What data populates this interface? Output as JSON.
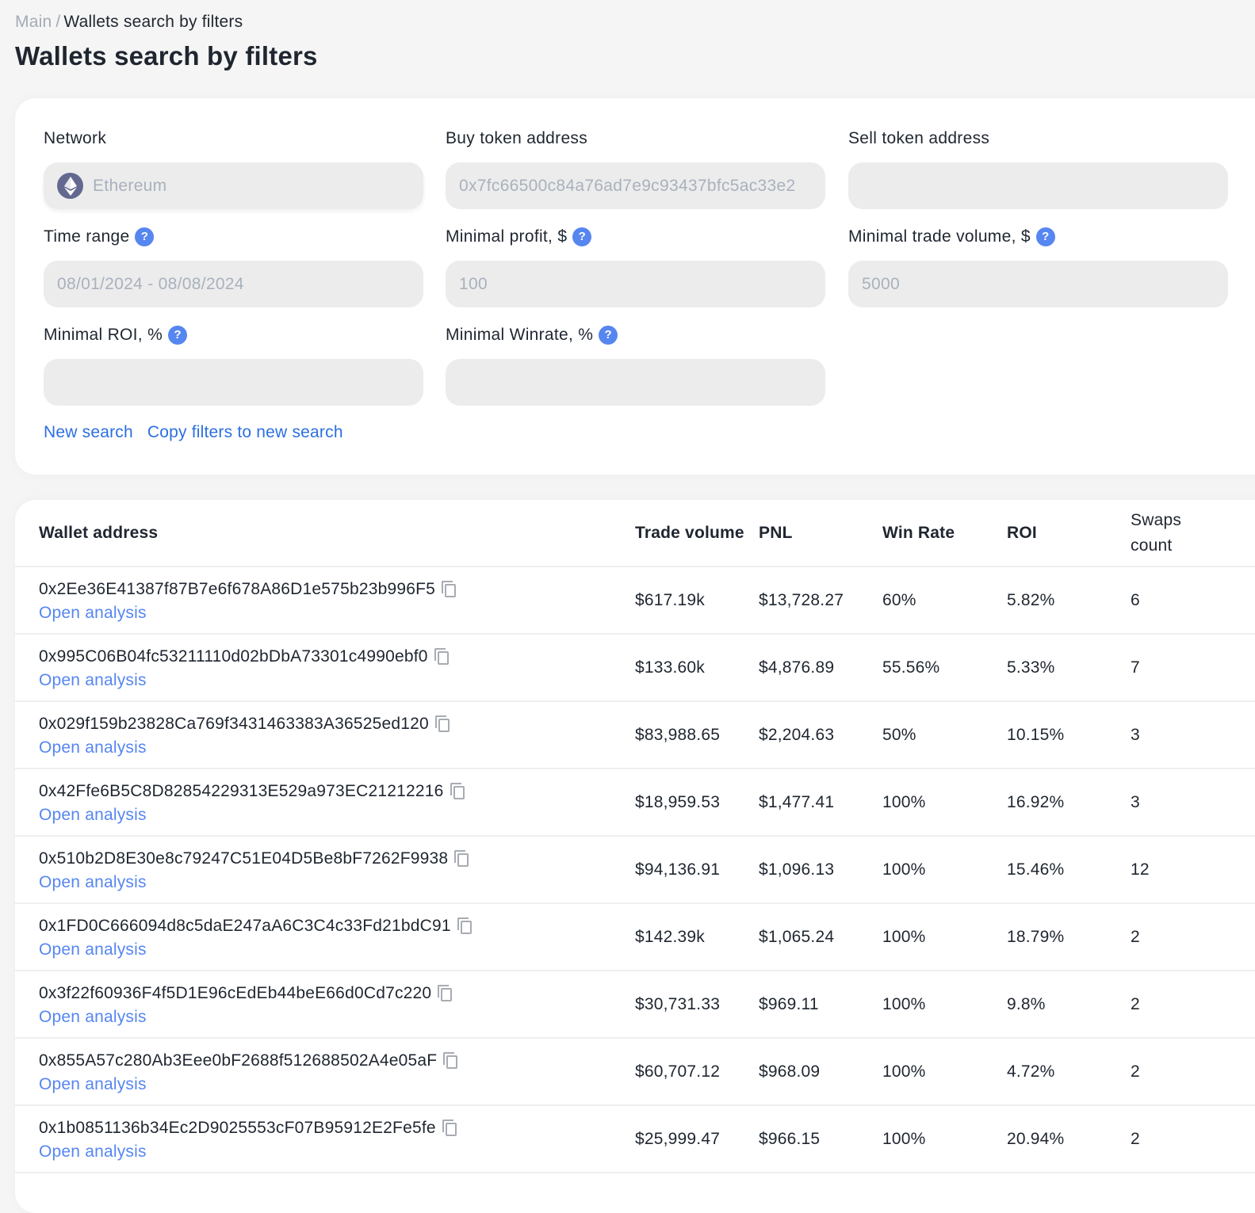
{
  "breadcrumb": {
    "root": "Main",
    "separator": "/",
    "current": "Wallets search by filters"
  },
  "page_title": "Wallets search by filters",
  "colors": {
    "accent": "#2c6fe0",
    "link": "#5686f0",
    "help": "#5686f0",
    "eth": "#62688f",
    "input_bg": "#ececec"
  },
  "filters": {
    "network": {
      "label": "Network",
      "value": "Ethereum",
      "icon": "ethereum-icon"
    },
    "buy_token": {
      "label": "Buy token address",
      "value": "0x7fc66500c84a76ad7e9c93437bfc5ac33e2"
    },
    "sell_token": {
      "label": "Sell token address",
      "value": ""
    },
    "time_range": {
      "label": "Time range",
      "value": "08/01/2024 - 08/08/2024",
      "help": "?"
    },
    "min_profit": {
      "label": "Minimal profit, $",
      "value": "100",
      "help": "?"
    },
    "min_volume": {
      "label": "Minimal trade volume, $",
      "value": "5000",
      "help": "?"
    },
    "min_roi": {
      "label": "Minimal ROI, %",
      "value": "",
      "help": "?"
    },
    "min_winrate": {
      "label": "Minimal Winrate, %",
      "value": "",
      "help": "?"
    },
    "actions": {
      "new_search": "New search",
      "copy_filters": "Copy filters to new search"
    }
  },
  "table": {
    "headers": {
      "wallet": "Wallet address",
      "volume": "Trade volume",
      "pnl": "PNL",
      "winrate": "Win Rate",
      "roi": "ROI",
      "swaps_line1": "Swaps",
      "swaps_line2": "count"
    },
    "open_label": "Open analysis",
    "rows": [
      {
        "address": "0x2Ee36E41387f87B7e6f678A86D1e575b23b996F5",
        "volume": "$617.19k",
        "pnl": "$13,728.27",
        "winrate": "60%",
        "roi": "5.82%",
        "swaps": "6"
      },
      {
        "address": "0x995C06B04fc53211110d02bDbA73301c4990ebf0",
        "volume": "$133.60k",
        "pnl": "$4,876.89",
        "winrate": "55.56%",
        "roi": "5.33%",
        "swaps": "7"
      },
      {
        "address": "0x029f159b23828Ca769f3431463383A36525ed120",
        "volume": "$83,988.65",
        "pnl": "$2,204.63",
        "winrate": "50%",
        "roi": "10.15%",
        "swaps": "3"
      },
      {
        "address": "0x42Ffe6B5C8D82854229313E529a973EC21212216",
        "volume": "$18,959.53",
        "pnl": "$1,477.41",
        "winrate": "100%",
        "roi": "16.92%",
        "swaps": "3"
      },
      {
        "address": "0x510b2D8E30e8c79247C51E04D5Be8bF7262F9938",
        "volume": "$94,136.91",
        "pnl": "$1,096.13",
        "winrate": "100%",
        "roi": "15.46%",
        "swaps": "12"
      },
      {
        "address": "0x1FD0C666094d8c5daE247aA6C3C4c33Fd21bdC91",
        "volume": "$142.39k",
        "pnl": "$1,065.24",
        "winrate": "100%",
        "roi": "18.79%",
        "swaps": "2"
      },
      {
        "address": "0x3f22f60936F4f5D1E96cEdEb44beE66d0Cd7c220",
        "volume": "$30,731.33",
        "pnl": "$969.11",
        "winrate": "100%",
        "roi": "9.8%",
        "swaps": "2"
      },
      {
        "address": "0x855A57c280Ab3Eee0bF2688f512688502A4e05aF",
        "volume": "$60,707.12",
        "pnl": "$968.09",
        "winrate": "100%",
        "roi": "4.72%",
        "swaps": "2"
      },
      {
        "address": "0x1b0851136b34Ec2D9025553cF07B95912E2Fe5fe",
        "volume": "$25,999.47",
        "pnl": "$966.15",
        "winrate": "100%",
        "roi": "20.94%",
        "swaps": "2"
      }
    ]
  }
}
